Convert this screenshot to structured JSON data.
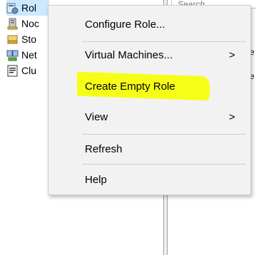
{
  "tree": {
    "items": [
      {
        "label": "Rol",
        "icon": "roles-icon"
      },
      {
        "label": "Noc",
        "icon": "nodes-icon"
      },
      {
        "label": "Sto",
        "icon": "storage-icon"
      },
      {
        "label": "Net",
        "icon": "networks-icon"
      },
      {
        "label": "Clu",
        "icon": "cluster-events-icon"
      }
    ]
  },
  "right_pane": {
    "search_placeholder": "Search",
    "fragments": [
      "ve",
      "ve"
    ]
  },
  "context_menu": {
    "items": [
      {
        "label": "Configure Role...",
        "has_submenu": false
      },
      {
        "label": "Virtual Machines...",
        "has_submenu": true
      },
      {
        "label": "Create Empty Role",
        "has_submenu": false,
        "highlighted": true
      },
      {
        "label": "View",
        "has_submenu": true
      },
      {
        "label": "Refresh",
        "has_submenu": false
      },
      {
        "label": "Help",
        "has_submenu": false
      }
    ],
    "submenu_arrow": ">",
    "highlight_color": "#f6ff00"
  }
}
